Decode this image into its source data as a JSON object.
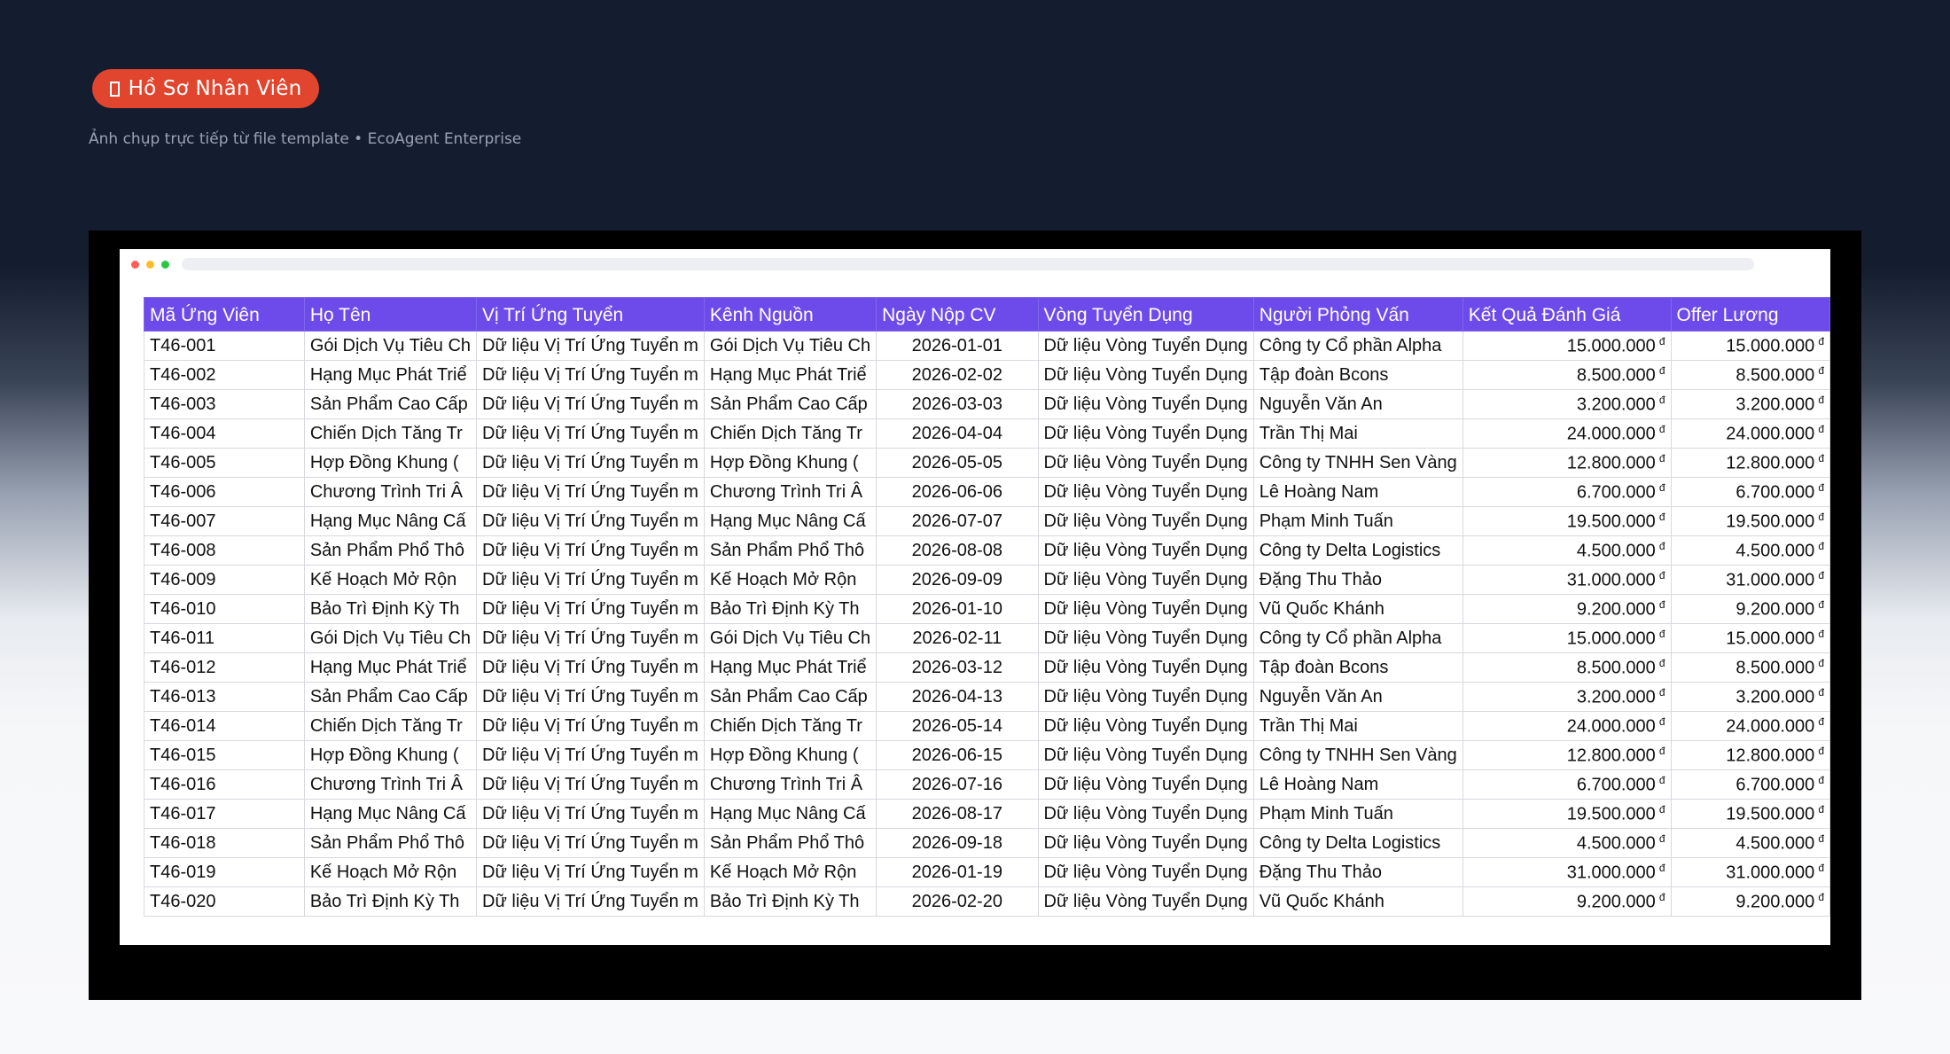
{
  "header": {
    "badge_label": "Hồ Sơ Nhân Viên",
    "badge_icon": "document-icon",
    "subtitle": "Ảnh chụp trực tiếp từ file template • EcoAgent Enterprise"
  },
  "window": {
    "dot_colors": [
      "#ff5f57",
      "#febc2e",
      "#28c840"
    ]
  },
  "colors": {
    "accent": "#e2452e",
    "header_fill": "#6d4bea"
  },
  "table": {
    "currency_symbol": "đ",
    "columns": [
      "Mã Ứng Viên",
      "Họ Tên",
      "Vị Trí Ứng Tuyển",
      "Kênh Nguồn",
      "Ngày Nộp CV",
      "Vòng Tuyển Dụng",
      "Người Phỏng Vấn",
      "Kết Quả Đánh Giá",
      "Offer Lương"
    ],
    "rows": [
      [
        "T46-001",
        "Gói Dịch Vụ Tiêu Ch",
        "Dữ liệu Vị Trí Ứng Tuyển m",
        "Gói Dịch Vụ Tiêu Ch",
        "2026-01-01",
        "Dữ liệu Vòng Tuyển Dụng",
        "Công ty Cổ phần Alpha",
        "15.000.000",
        "15.000.000"
      ],
      [
        "T46-002",
        "Hạng Mục Phát Triể",
        "Dữ liệu Vị Trí Ứng Tuyển m",
        "Hạng Mục Phát Triể",
        "2026-02-02",
        "Dữ liệu Vòng Tuyển Dụng",
        "Tập đoàn Bcons",
        "8.500.000",
        "8.500.000"
      ],
      [
        "T46-003",
        "Sản Phẩm Cao Cấp",
        "Dữ liệu Vị Trí Ứng Tuyển m",
        "Sản Phẩm Cao Cấp",
        "2026-03-03",
        "Dữ liệu Vòng Tuyển Dụng",
        "Nguyễn Văn An",
        "3.200.000",
        "3.200.000"
      ],
      [
        "T46-004",
        "Chiến Dịch Tăng Tr",
        "Dữ liệu Vị Trí Ứng Tuyển m",
        "Chiến Dịch Tăng Tr",
        "2026-04-04",
        "Dữ liệu Vòng Tuyển Dụng",
        "Trần Thị Mai",
        "24.000.000",
        "24.000.000"
      ],
      [
        "T46-005",
        "Hợp Đồng Khung (",
        "Dữ liệu Vị Trí Ứng Tuyển m",
        "Hợp Đồng Khung (",
        "2026-05-05",
        "Dữ liệu Vòng Tuyển Dụng",
        "Công ty TNHH Sen Vàng",
        "12.800.000",
        "12.800.000"
      ],
      [
        "T46-006",
        "Chương Trình Tri Â",
        "Dữ liệu Vị Trí Ứng Tuyển m",
        "Chương Trình Tri Â",
        "2026-06-06",
        "Dữ liệu Vòng Tuyển Dụng",
        "Lê Hoàng Nam",
        "6.700.000",
        "6.700.000"
      ],
      [
        "T46-007",
        "Hạng Mục Nâng Cấ",
        "Dữ liệu Vị Trí Ứng Tuyển m",
        "Hạng Mục Nâng Cấ",
        "2026-07-07",
        "Dữ liệu Vòng Tuyển Dụng",
        "Phạm Minh Tuấn",
        "19.500.000",
        "19.500.000"
      ],
      [
        "T46-008",
        "Sản Phẩm Phổ Thô",
        "Dữ liệu Vị Trí Ứng Tuyển m",
        "Sản Phẩm Phổ Thô",
        "2026-08-08",
        "Dữ liệu Vòng Tuyển Dụng",
        "Công ty Delta Logistics",
        "4.500.000",
        "4.500.000"
      ],
      [
        "T46-009",
        "Kế Hoạch Mở Rộn",
        "Dữ liệu Vị Trí Ứng Tuyển m",
        "Kế Hoạch Mở Rộn",
        "2026-09-09",
        "Dữ liệu Vòng Tuyển Dụng",
        "Đặng Thu Thảo",
        "31.000.000",
        "31.000.000"
      ],
      [
        "T46-010",
        "Bảo Trì Định Kỳ Th",
        "Dữ liệu Vị Trí Ứng Tuyển m",
        "Bảo Trì Định Kỳ Th",
        "2026-01-10",
        "Dữ liệu Vòng Tuyển Dụng",
        "Vũ Quốc Khánh",
        "9.200.000",
        "9.200.000"
      ],
      [
        "T46-011",
        "Gói Dịch Vụ Tiêu Ch",
        "Dữ liệu Vị Trí Ứng Tuyển m",
        "Gói Dịch Vụ Tiêu Ch",
        "2026-02-11",
        "Dữ liệu Vòng Tuyển Dụng",
        "Công ty Cổ phần Alpha",
        "15.000.000",
        "15.000.000"
      ],
      [
        "T46-012",
        "Hạng Mục Phát Triể",
        "Dữ liệu Vị Trí Ứng Tuyển m",
        "Hạng Mục Phát Triể",
        "2026-03-12",
        "Dữ liệu Vòng Tuyển Dụng",
        "Tập đoàn Bcons",
        "8.500.000",
        "8.500.000"
      ],
      [
        "T46-013",
        "Sản Phẩm Cao Cấp",
        "Dữ liệu Vị Trí Ứng Tuyển m",
        "Sản Phẩm Cao Cấp",
        "2026-04-13",
        "Dữ liệu Vòng Tuyển Dụng",
        "Nguyễn Văn An",
        "3.200.000",
        "3.200.000"
      ],
      [
        "T46-014",
        "Chiến Dịch Tăng Tr",
        "Dữ liệu Vị Trí Ứng Tuyển m",
        "Chiến Dịch Tăng Tr",
        "2026-05-14",
        "Dữ liệu Vòng Tuyển Dụng",
        "Trần Thị Mai",
        "24.000.000",
        "24.000.000"
      ],
      [
        "T46-015",
        "Hợp Đồng Khung (",
        "Dữ liệu Vị Trí Ứng Tuyển m",
        "Hợp Đồng Khung (",
        "2026-06-15",
        "Dữ liệu Vòng Tuyển Dụng",
        "Công ty TNHH Sen Vàng",
        "12.800.000",
        "12.800.000"
      ],
      [
        "T46-016",
        "Chương Trình Tri Â",
        "Dữ liệu Vị Trí Ứng Tuyển m",
        "Chương Trình Tri Â",
        "2026-07-16",
        "Dữ liệu Vòng Tuyển Dụng",
        "Lê Hoàng Nam",
        "6.700.000",
        "6.700.000"
      ],
      [
        "T46-017",
        "Hạng Mục Nâng Cấ",
        "Dữ liệu Vị Trí Ứng Tuyển m",
        "Hạng Mục Nâng Cấ",
        "2026-08-17",
        "Dữ liệu Vòng Tuyển Dụng",
        "Phạm Minh Tuấn",
        "19.500.000",
        "19.500.000"
      ],
      [
        "T46-018",
        "Sản Phẩm Phổ Thô",
        "Dữ liệu Vị Trí Ứng Tuyển m",
        "Sản Phẩm Phổ Thô",
        "2026-09-18",
        "Dữ liệu Vòng Tuyển Dụng",
        "Công ty Delta Logistics",
        "4.500.000",
        "4.500.000"
      ],
      [
        "T46-019",
        "Kế Hoạch Mở Rộn",
        "Dữ liệu Vị Trí Ứng Tuyển m",
        "Kế Hoạch Mở Rộn",
        "2026-01-19",
        "Dữ liệu Vòng Tuyển Dụng",
        "Đặng Thu Thảo",
        "31.000.000",
        "31.000.000"
      ],
      [
        "T46-020",
        "Bảo Trì Định Kỳ Th",
        "Dữ liệu Vị Trí Ứng Tuyển m",
        "Bảo Trì Định Kỳ Th",
        "2026-02-20",
        "Dữ liệu Vòng Tuyển Dụng",
        "Vũ Quốc Khánh",
        "9.200.000",
        "9.200.000"
      ]
    ]
  }
}
